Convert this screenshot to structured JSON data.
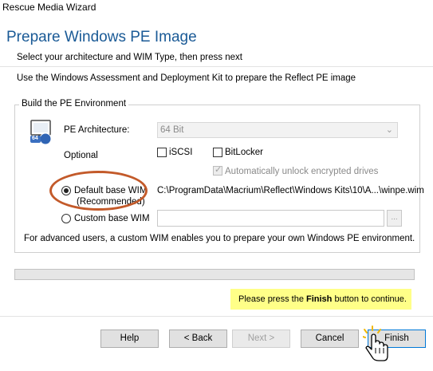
{
  "window": {
    "title": "Rescue Media Wizard",
    "heading": "Prepare Windows PE Image",
    "instruction": "Select your architecture and WIM Type, then press next",
    "adk_note": "Use the Windows Assessment and Deployment Kit to prepare the Reflect PE image"
  },
  "group": {
    "legend": "Build the PE Environment",
    "arch_label": "PE Architecture:",
    "arch_value": "64 Bit",
    "optional_label": "Optional",
    "iscsi_label": "iSCSI",
    "bitlocker_label": "BitLocker",
    "auto_unlock_label": "Automatically unlock encrypted drives",
    "default_wim_label_1": "Default base WIM",
    "default_wim_label_2": "(Recommended)",
    "default_wim_path": "C:\\ProgramData\\Macrium\\Reflect\\Windows Kits\\10\\A...\\winpe.wim",
    "custom_wim_label": "Custom base WIM",
    "custom_wim_value": "",
    "browse_label": "...",
    "advanced_note": "For advanced users, a custom WIM enables you to prepare your own Windows PE environment.",
    "icon_badge": "64"
  },
  "progress": {
    "value": 0
  },
  "notice": {
    "prefix": "Please press the ",
    "bold": "Finish",
    "suffix": " button to continue."
  },
  "buttons": {
    "help": "Help",
    "back": "< Back",
    "next": "Next >",
    "cancel": "Cancel",
    "finish": "Finish"
  },
  "colors": {
    "heading": "#1a5a96",
    "annotation_ellipse": "#c35a2a",
    "notice_bg": "#ffff88",
    "progress_fill": "#06b025"
  }
}
